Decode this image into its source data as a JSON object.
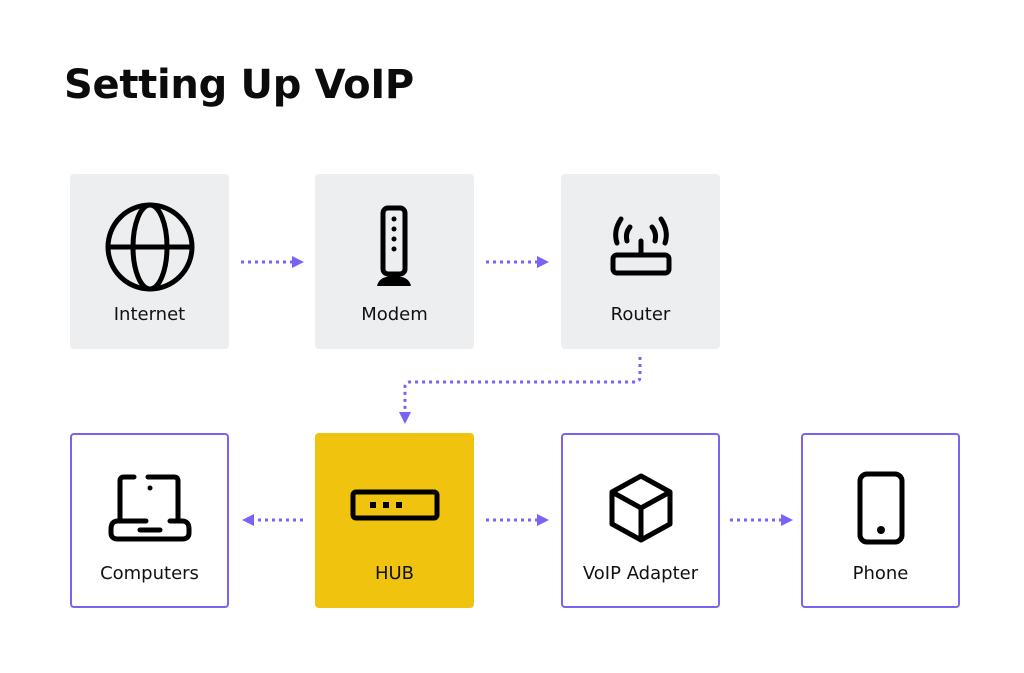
{
  "title": "Setting Up VoIP",
  "accent_color": "#7c62f2",
  "highlight_color": "#f0c30f",
  "nodes": [
    {
      "id": "internet",
      "label": "Internet",
      "icon": "globe-icon",
      "style": "grey"
    },
    {
      "id": "modem",
      "label": "Modem",
      "icon": "modem-icon",
      "style": "grey"
    },
    {
      "id": "router",
      "label": "Router",
      "icon": "router-icon",
      "style": "grey"
    },
    {
      "id": "computers",
      "label": "Computers",
      "icon": "laptop-icon",
      "style": "outline"
    },
    {
      "id": "hub",
      "label": "HUB",
      "icon": "hub-icon",
      "style": "highlight"
    },
    {
      "id": "voip-adapter",
      "label": "VoIP Adapter",
      "icon": "cube-icon",
      "style": "outline"
    },
    {
      "id": "phone",
      "label": "Phone",
      "icon": "phone-icon",
      "style": "outline"
    }
  ],
  "edges": [
    {
      "from": "internet",
      "to": "modem"
    },
    {
      "from": "modem",
      "to": "router"
    },
    {
      "from": "router",
      "to": "hub"
    },
    {
      "from": "hub",
      "to": "computers"
    },
    {
      "from": "hub",
      "to": "voip-adapter"
    },
    {
      "from": "voip-adapter",
      "to": "phone"
    }
  ]
}
